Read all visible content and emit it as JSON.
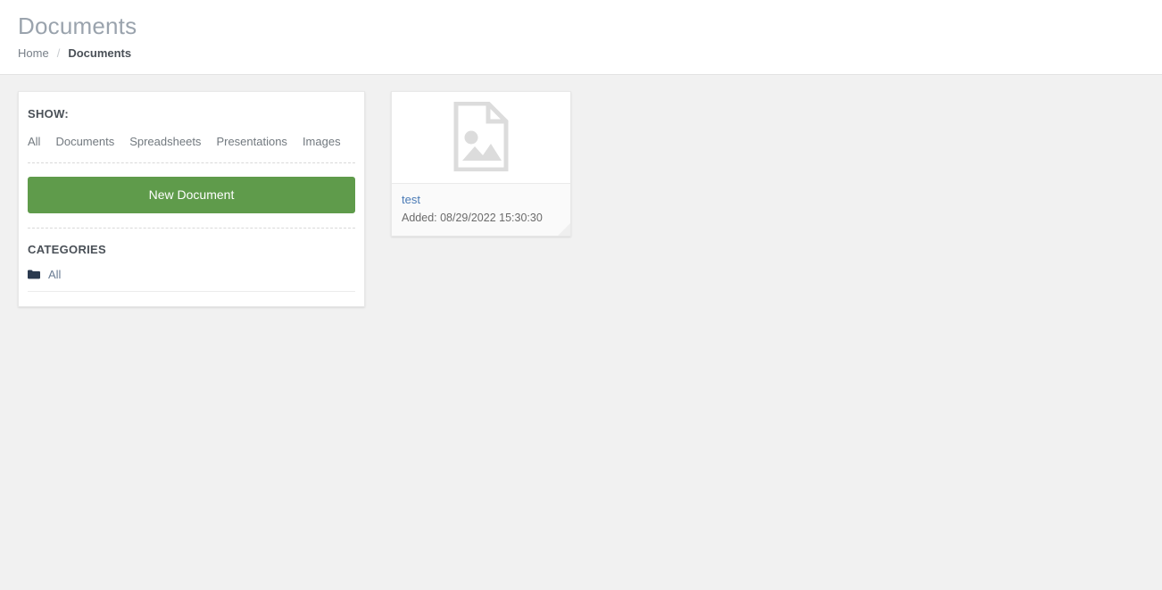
{
  "header": {
    "title": "Documents",
    "breadcrumb": {
      "home_label": "Home",
      "separator": "/",
      "current_label": "Documents"
    }
  },
  "sidebar": {
    "show_heading": "SHOW:",
    "filters": [
      {
        "label": "All"
      },
      {
        "label": "Documents"
      },
      {
        "label": "Spreadsheets"
      },
      {
        "label": "Presentations"
      },
      {
        "label": "Images"
      }
    ],
    "new_document_label": "New Document",
    "new_document_color": "#5f9b4b",
    "categories_heading": "CATEGORIES",
    "categories": [
      {
        "label": "All",
        "icon": "folder-icon"
      }
    ]
  },
  "documents": [
    {
      "name": "test",
      "added_label": "Added: 08/29/2022 15:30:30",
      "icon": "file-image-icon",
      "link_color": "#4a7ab5"
    }
  ]
}
